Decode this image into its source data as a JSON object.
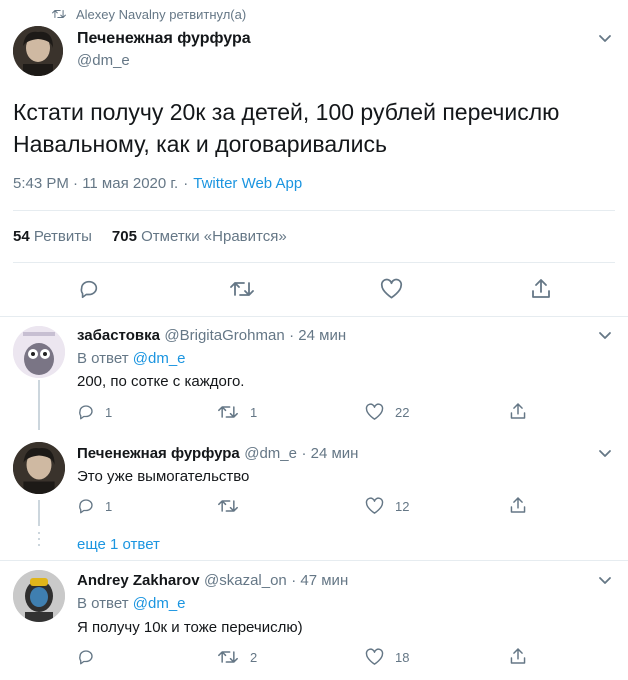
{
  "retweet_banner": "Alexey Navalny ретвитнул(а)",
  "main": {
    "name": "Печенежная фурфура",
    "handle": "@dm_e",
    "text_line1": "Кстати получу 20к за детей, 100 рублей перечислю",
    "text_line2": "Навальному, как и договаривались",
    "time": "5:43 PM · 11 мая 2020 г.",
    "dot": "·",
    "source": "Twitter Web App",
    "retweets_count": "54",
    "retweets_label": "Ретвиты",
    "likes_count": "705",
    "likes_label": "Отметки «Нравится»"
  },
  "replies": [
    {
      "name": "забастовка",
      "handle": "@BrigitaGrohman",
      "time": "· 24 мин",
      "reply_to_label": "В ответ",
      "reply_to_handle": "@dm_e",
      "text": "200, по сотке с каждого.",
      "reply_count": "1",
      "retweet_count": "1",
      "like_count": "22"
    },
    {
      "name": "Печенежная фурфура",
      "handle": "@dm_e",
      "time": "· 24 мин",
      "text": "Это уже вымогательство",
      "reply_count": "1",
      "retweet_count": "",
      "like_count": "12"
    },
    {
      "name": "Andrey Zakharov",
      "handle": "@skazal_on",
      "time": "· 47 мин",
      "reply_to_label": "В ответ",
      "reply_to_handle": "@dm_e",
      "text": "Я получу 10к и тоже перечислю)",
      "reply_count": "",
      "retweet_count": "2",
      "like_count": "18"
    }
  ],
  "more_replies": "еще 1 ответ",
  "colors": {
    "accent": "#1b95e0",
    "muted": "#657786",
    "text": "#14171a",
    "divider": "#e6ecf0"
  },
  "icons": [
    "retweet-icon",
    "chevron-down-icon",
    "reply-icon",
    "like-icon",
    "share-icon"
  ]
}
